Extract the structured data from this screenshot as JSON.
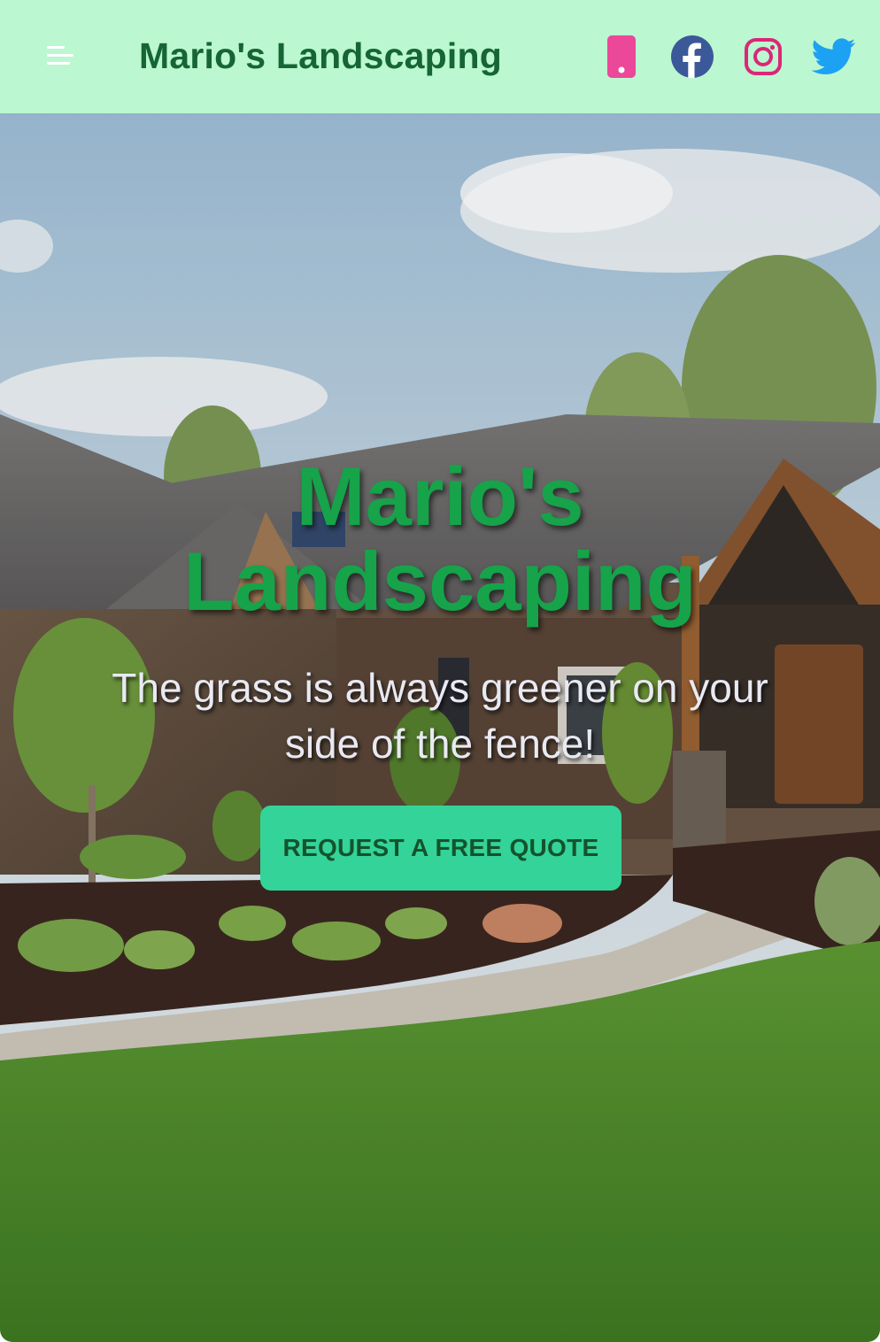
{
  "navbar": {
    "brand": "Mario's Landscaping",
    "menu_icon": "hamburger-menu-icon",
    "socials": [
      {
        "name": "phone",
        "icon": "phone-icon",
        "color": "#ec4899"
      },
      {
        "name": "facebook",
        "icon": "facebook-icon",
        "color": "#3b5998"
      },
      {
        "name": "instagram",
        "icon": "instagram-icon",
        "color": "#db2777"
      },
      {
        "name": "twitter",
        "icon": "twitter-icon",
        "color": "#1da1f2"
      }
    ],
    "background": "#bbf7d0",
    "brand_color": "#166534"
  },
  "hero": {
    "title_line1": "Mario's",
    "title_line2": "Landscaping",
    "subtitle": "The grass is always greener on your side of the fence!",
    "cta_label": "REQUEST A FREE QUOTE",
    "title_color": "#16a34a",
    "cta_color": "#34d399"
  }
}
